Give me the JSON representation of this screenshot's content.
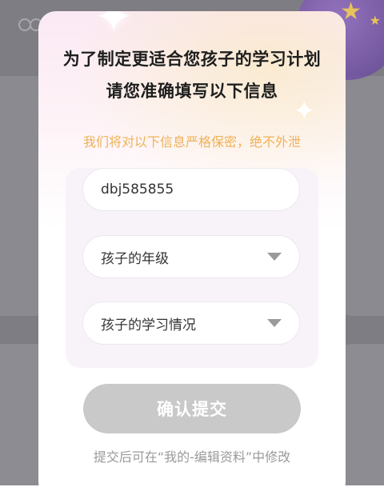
{
  "dialog": {
    "title_line1": "为了制定更适合您孩子的学习计划",
    "title_line2": "请您准确填写以下信息",
    "privacy_notice": "我们将对以下信息严格保密，绝不外泄",
    "fields": {
      "child_name_value": "dbj585855",
      "grade_placeholder": "孩子的年级",
      "study_status_placeholder": "孩子的学习情况"
    },
    "submit_label": "确认提交",
    "footer_hint": "提交后可在“我的-编辑资料”中修改"
  },
  "colors": {
    "notice": "#f0b15a",
    "submit_disabled_bg": "#c9c9c9",
    "hint": "#9a9a9a",
    "overlay": "#7d7d83"
  },
  "icons": {
    "dropdown": "chevron-down-icon",
    "decoration": "sparkle-icon"
  }
}
